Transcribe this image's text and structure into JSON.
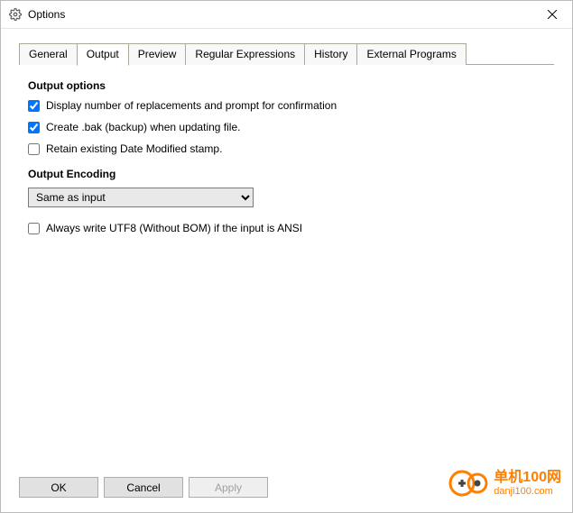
{
  "window": {
    "title": "Options"
  },
  "tabs": {
    "general": "General",
    "output": "Output",
    "preview": "Preview",
    "regex": "Regular Expressions",
    "history": "History",
    "external": "External Programs",
    "active": "output"
  },
  "output": {
    "section_options": "Output options",
    "chk_display": "Display number of replacements and prompt for confirmation",
    "chk_bak": "Create .bak (backup) when updating file.",
    "chk_retain": "Retain existing Date Modified stamp.",
    "section_encoding": "Output Encoding",
    "encoding_selected": "Same as input",
    "chk_utf8": "Always write UTF8 (Without BOM) if the input is ANSI"
  },
  "buttons": {
    "ok": "OK",
    "cancel": "Cancel",
    "apply": "Apply"
  },
  "watermark": {
    "cn": "单机100网",
    "url": "danji100.com"
  }
}
